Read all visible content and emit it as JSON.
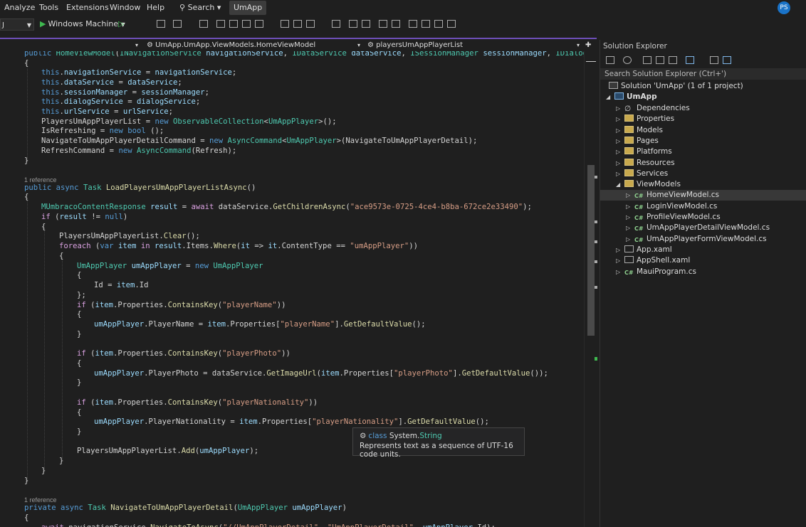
{
  "menubar": {
    "items": [
      "Analyze",
      "Tools",
      "Extensions",
      "Window",
      "Help"
    ],
    "search_label": "Search",
    "app_name": "UmApp",
    "avatar_initials": "PS"
  },
  "toolbar": {
    "config_value": "J",
    "run_target": "Windows Machine"
  },
  "navbar": {
    "type_path": "UmApp.UmApp.ViewModels.HomeViewModel",
    "member": "playersUmAppPlayerList"
  },
  "editor": {
    "references": [
      "1 reference",
      "1 reference"
    ]
  },
  "tooltip": {
    "kind": "class",
    "type_ns": "System.",
    "type_name": "String",
    "description": "Represents text as a sequence of UTF-16 code units."
  },
  "solution_explorer": {
    "title": "Solution Explorer",
    "search_placeholder": "Search Solution Explorer (Ctrl+')",
    "solution_label": "Solution 'UmApp' (1 of 1 project)",
    "project": "UmApp",
    "items": [
      {
        "label": "Dependencies",
        "icon": "dependencies-icon"
      },
      {
        "label": "Properties",
        "icon": "properties-icon"
      },
      {
        "label": "Models",
        "icon": "folder-icon"
      },
      {
        "label": "Pages",
        "icon": "folder-icon"
      },
      {
        "label": "Platforms",
        "icon": "folder-icon"
      },
      {
        "label": "Resources",
        "icon": "folder-icon"
      },
      {
        "label": "Services",
        "icon": "folder-icon"
      },
      {
        "label": "ViewModels",
        "icon": "folder-open-icon"
      },
      {
        "label": "HomeViewModel.cs",
        "icon": "csharp-file-icon"
      },
      {
        "label": "LoginViewModel.cs",
        "icon": "csharp-file-icon"
      },
      {
        "label": "ProfileViewModel.cs",
        "icon": "csharp-file-icon"
      },
      {
        "label": "UmAppPlayerDetailViewModel.cs",
        "icon": "csharp-file-icon"
      },
      {
        "label": "UmAppPlayerFormViewModel.cs",
        "icon": "csharp-file-icon"
      },
      {
        "label": "App.xaml",
        "icon": "xaml-file-icon"
      },
      {
        "label": "AppShell.xaml",
        "icon": "xaml-file-icon"
      },
      {
        "label": "MauiProgram.cs",
        "icon": "csharp-file-icon"
      }
    ]
  }
}
